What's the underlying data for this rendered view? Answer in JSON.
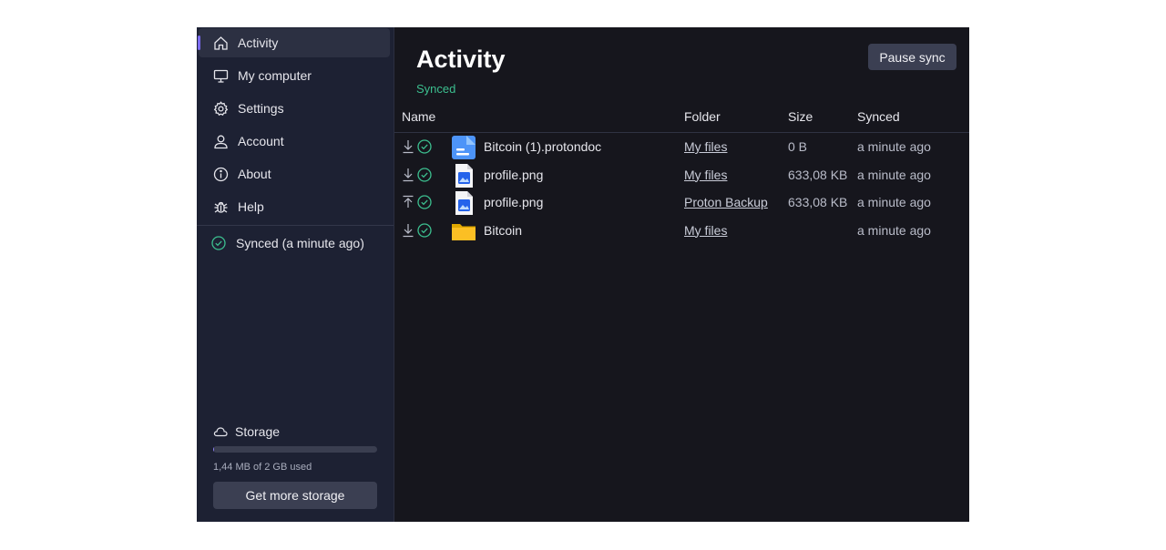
{
  "sidebar": {
    "items": [
      {
        "label": "Activity",
        "icon": "home-icon",
        "active": true
      },
      {
        "label": "My computer",
        "icon": "monitor-icon"
      },
      {
        "label": "Settings",
        "icon": "gear-icon"
      },
      {
        "label": "Account",
        "icon": "user-icon"
      },
      {
        "label": "About",
        "icon": "info-icon"
      },
      {
        "label": "Help",
        "icon": "bug-icon"
      }
    ],
    "sync_status": "Synced (a minute ago)",
    "storage": {
      "title": "Storage",
      "used_text": "1,44 MB of 2 GB used",
      "used_fraction": 0.0007,
      "button_label": "Get more storage"
    }
  },
  "main": {
    "title": "Activity",
    "status": "Synced",
    "pause_label": "Pause sync",
    "columns": {
      "name": "Name",
      "folder": "Folder",
      "size": "Size",
      "synced": "Synced"
    },
    "rows": [
      {
        "direction": "download",
        "type": "protondoc",
        "name": "Bitcoin (1).protondoc",
        "folder": "My files",
        "size": "0 B",
        "synced": "a minute ago"
      },
      {
        "direction": "download",
        "type": "image",
        "name": "profile.png",
        "folder": "My files",
        "size": "633,08 KB",
        "synced": "a minute ago"
      },
      {
        "direction": "upload",
        "type": "image",
        "name": "profile.png",
        "folder": "Proton Backup",
        "size": "633,08 KB",
        "synced": "a minute ago"
      },
      {
        "direction": "download",
        "type": "folder",
        "name": "Bitcoin",
        "folder": "My files",
        "size": "",
        "synced": "a minute ago"
      }
    ]
  },
  "colors": {
    "accent": "#7c6cf0",
    "success": "#3cbf8f",
    "sidebar_bg": "#1d2133",
    "main_bg": "#16161d"
  }
}
